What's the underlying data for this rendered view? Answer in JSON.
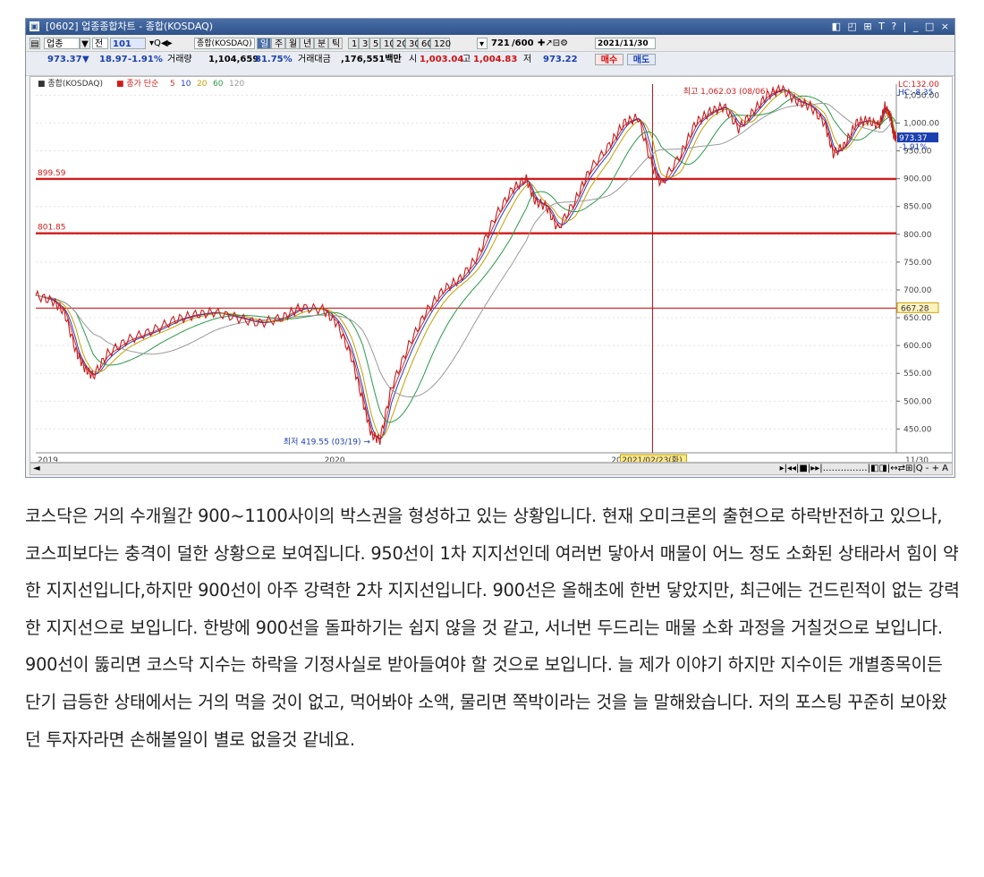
{
  "window": {
    "title": "[0602] 업종종합차트 - 종합(KOSDAQ)",
    "title_controls": "◧ ◰ ⊞ T ? | _ □ ×"
  },
  "toolbar1": {
    "sector_btn": "업종",
    "sector_dropdown": "▼",
    "period_btn": "전",
    "code_input": "101",
    "name_input": "종합(KOSDAQ)",
    "period_tabs": [
      "일",
      "주",
      "월",
      "년",
      "분",
      "틱"
    ],
    "intervals": [
      "1",
      "3",
      "5",
      "10",
      "20",
      "30",
      "60",
      "120"
    ],
    "count_value": "721",
    "count_total": "/600",
    "date_input": "2021/11/30"
  },
  "toolbar2": {
    "price": "973.37",
    "change_arrow": "▼",
    "change": "18.97",
    "change_pct": "-1.91%",
    "volume_label": "거래량",
    "volume": "1,104,659",
    "volume_pct": "81.75%",
    "amount_label": "거래대금",
    "amount": ",176,551백만",
    "open_label": "시",
    "open": "1,003.04",
    "high_label": "고",
    "high": "1,004.83",
    "low_label": "저",
    "low": "973.22",
    "buy_btn": "매수",
    "sell_btn": "매도"
  },
  "chart_data": {
    "type": "line",
    "legend": {
      "main": "종합(KOSDAQ)",
      "ma_title": "종가 단순",
      "ma_periods": [
        "5",
        "10",
        "20",
        "60",
        "120"
      ],
      "ma_colors": [
        "#d03030",
        "#2040c0",
        "#c8a000",
        "#2a9a4a",
        "#9a9a9a"
      ]
    },
    "x_ticks": [
      "2019",
      "2020",
      "2021",
      "11/30"
    ],
    "crosshair_label": "2021/02/23(화)",
    "y_ticks": [
      "1,050.00",
      "1,000.00",
      "950.00",
      "900.00",
      "850.00",
      "800.00",
      "750.00",
      "700.00",
      "650.00",
      "600.00",
      "550.00",
      "500.00",
      "450.00"
    ],
    "ylim": [
      420,
      1070
    ],
    "series": [
      {
        "name": "종합(KOSDAQ)",
        "points": [
          [
            2019.0,
            690
          ],
          [
            2019.06,
            680
          ],
          [
            2019.1,
            660
          ],
          [
            2019.14,
            590
          ],
          [
            2019.17,
            560
          ],
          [
            2019.2,
            545
          ],
          [
            2019.25,
            585
          ],
          [
            2019.32,
            610
          ],
          [
            2019.4,
            625
          ],
          [
            2019.48,
            645
          ],
          [
            2019.55,
            655
          ],
          [
            2019.62,
            660
          ],
          [
            2019.7,
            650
          ],
          [
            2019.78,
            640
          ],
          [
            2019.86,
            650
          ],
          [
            2019.92,
            668
          ],
          [
            2020.0,
            665
          ],
          [
            2020.05,
            640
          ],
          [
            2020.1,
            580
          ],
          [
            2020.14,
            500
          ],
          [
            2020.17,
            440
          ],
          [
            2020.2,
            430
          ],
          [
            2020.24,
            525
          ],
          [
            2020.3,
            600
          ],
          [
            2020.36,
            660
          ],
          [
            2020.42,
            700
          ],
          [
            2020.48,
            720
          ],
          [
            2020.54,
            760
          ],
          [
            2020.6,
            830
          ],
          [
            2020.66,
            880
          ],
          [
            2020.71,
            900
          ],
          [
            2020.74,
            860
          ],
          [
            2020.78,
            850
          ],
          [
            2020.82,
            810
          ],
          [
            2020.88,
            860
          ],
          [
            2020.93,
            915
          ],
          [
            2021.0,
            960
          ],
          [
            2021.05,
            1000
          ],
          [
            2021.1,
            1010
          ],
          [
            2021.15,
            920
          ],
          [
            2021.18,
            890
          ],
          [
            2021.25,
            945
          ],
          [
            2021.3,
            1000
          ],
          [
            2021.35,
            1020
          ],
          [
            2021.4,
            1030
          ],
          [
            2021.45,
            990
          ],
          [
            2021.5,
            1020
          ],
          [
            2021.55,
            1050
          ],
          [
            2021.6,
            1062
          ],
          [
            2021.65,
            1040
          ],
          [
            2021.7,
            1030
          ],
          [
            2021.75,
            1000
          ],
          [
            2021.78,
            945
          ],
          [
            2021.82,
            960
          ],
          [
            2021.86,
            1000
          ],
          [
            2021.9,
            1005
          ],
          [
            2021.94,
            995
          ],
          [
            2021.96,
            1030
          ],
          [
            2021.98,
            1010
          ],
          [
            2021.99,
            980
          ],
          [
            2022.0,
            973.37
          ]
        ]
      }
    ],
    "hlines": [
      {
        "value": 899.59,
        "label": "899.59"
      },
      {
        "value": 801.85,
        "label": "801.85"
      },
      {
        "value": 667.28,
        "label": "667.28"
      }
    ],
    "annotations": [
      {
        "text": "최고 1,062.03 (08/06)",
        "x": 2021.6,
        "y": 1062.03
      },
      {
        "text": "최저 419.55 (03/19)",
        "x": 2020.2,
        "y": 419.55
      }
    ],
    "right_labels": {
      "lc": "LC:132.00",
      "hc": "HC:-8.35",
      "last_price": "973.37",
      "last_pct": "-1.91%",
      "hline_marker": "667.28"
    }
  },
  "bottom": {
    "scroll_left": "◄",
    "nav": "▸|◂◂|■|▸▸|……………|◧◨|↔⇄⊞|Q - + A"
  },
  "paragraph": "코스닥은 거의 수개월간 900~1100사이의 박스권을 형성하고 있는 상황입니다. 현재 오미크론의 출현으로 하락반전하고 있으나, 코스피보다는 충격이 덜한 상황으로 보여집니다. 950선이 1차 지지선인데 여러번 닿아서 매물이 어느 정도 소화된 상태라서 힘이 약한 지지선입니다,하지만  900선이 아주 강력한 2차 지지선입니다. 900선은 올해초에 한번 닿았지만, 최근에는 건드린적이 없는 강력한 지지선으로 보입니다. 한방에 900선을 돌파하기는 쉽지 않을 것 같고, 서너번 두드리는 매물 소화 과정을 거칠것으로 보입니다. 900선이 뚫리면 코스닥 지수는 하락을 기정사실로 받아들여야 할 것으로 보입니다. 늘 제가 이야기 하지만 지수이든 개별종목이든 단기 급등한 상태에서는 거의 먹을 것이 없고, 먹어봐야 소액, 물리면 쪽박이라는 것을 늘 말해왔습니다. 저의 포스팅 꾸준히 보아왔던 투자자라면 손해볼일이 별로 없을것 같네요."
}
